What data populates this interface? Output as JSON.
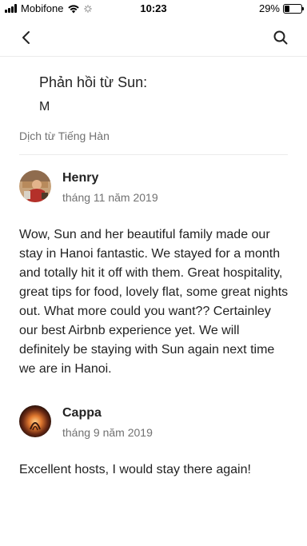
{
  "status_bar": {
    "carrier": "Mobifone",
    "time": "10:23",
    "battery_percent": "29%",
    "battery_level": 0.29
  },
  "nav": {
    "back_icon": "chevron-left-icon",
    "search_icon": "search-icon"
  },
  "host_response": {
    "heading": "Phản hồi từ Sun:",
    "text": "M"
  },
  "translation_note": "Dịch từ Tiếng Hàn",
  "reviews": [
    {
      "name": "Henry",
      "date": "tháng 11 năm 2019",
      "body": "Wow, Sun and her beautiful family made our stay in Hanoi fantastic. We stayed for a month and totally hit it off with them. Great hospitality, great tips for food, lovely flat, some great nights out. What more could you want?? Certainley our best Airbnb experience yet. We will definitely be staying with Sun again next time we are in Hanoi."
    },
    {
      "name": "Cappa",
      "date": "tháng 9 năm 2019",
      "body": "Excellent hosts, I would stay there again!"
    }
  ],
  "colors": {
    "text_primary": "#222222",
    "text_secondary": "#717171",
    "divider": "#ebebeb"
  }
}
